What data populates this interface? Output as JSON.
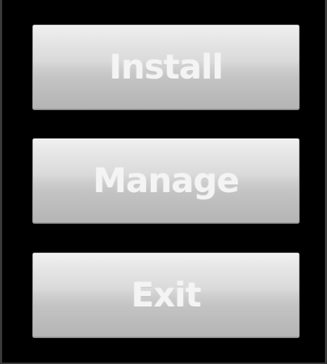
{
  "menu": {
    "buttons": [
      {
        "label": "Install"
      },
      {
        "label": "Manage"
      },
      {
        "label": "Exit"
      }
    ]
  }
}
